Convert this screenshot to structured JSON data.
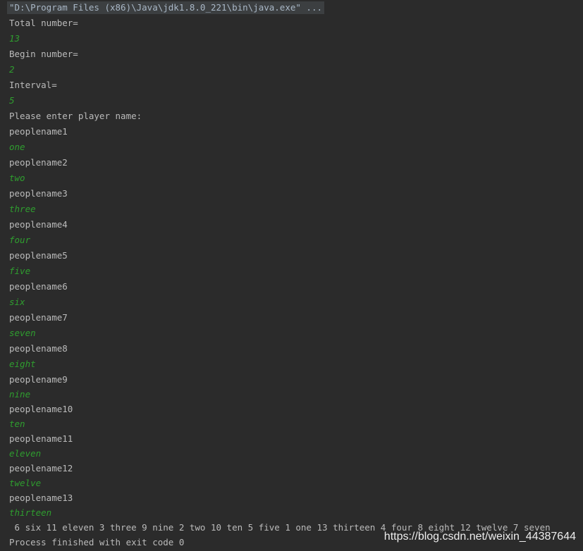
{
  "console": {
    "command": "\"D:\\Program Files (x86)\\Java\\jdk1.8.0_221\\bin\\java.exe\" ...",
    "lines": [
      {
        "text": "Total number=",
        "kind": "output"
      },
      {
        "text": "13",
        "kind": "input"
      },
      {
        "text": "Begin number=",
        "kind": "output"
      },
      {
        "text": "2",
        "kind": "input"
      },
      {
        "text": "Interval=",
        "kind": "output"
      },
      {
        "text": "5",
        "kind": "input"
      },
      {
        "text": "Please enter player name:",
        "kind": "output"
      },
      {
        "text": "peoplename1",
        "kind": "output"
      },
      {
        "text": "one",
        "kind": "input"
      },
      {
        "text": "peoplename2",
        "kind": "output"
      },
      {
        "text": "two",
        "kind": "input"
      },
      {
        "text": "peoplename3",
        "kind": "output"
      },
      {
        "text": "three",
        "kind": "input"
      },
      {
        "text": "peoplename4",
        "kind": "output"
      },
      {
        "text": "four",
        "kind": "input"
      },
      {
        "text": "peoplename5",
        "kind": "output"
      },
      {
        "text": "five",
        "kind": "input"
      },
      {
        "text": "peoplename6",
        "kind": "output"
      },
      {
        "text": "six",
        "kind": "input"
      },
      {
        "text": "peoplename7",
        "kind": "output"
      },
      {
        "text": "seven",
        "kind": "input"
      },
      {
        "text": "peoplename8",
        "kind": "output"
      },
      {
        "text": "eight",
        "kind": "input"
      },
      {
        "text": "peoplename9",
        "kind": "output"
      },
      {
        "text": "nine",
        "kind": "input"
      },
      {
        "text": "peoplename10",
        "kind": "output"
      },
      {
        "text": "ten",
        "kind": "input"
      },
      {
        "text": "peoplename11",
        "kind": "output"
      },
      {
        "text": "eleven",
        "kind": "input"
      },
      {
        "text": "peoplename12",
        "kind": "output"
      },
      {
        "text": "twelve",
        "kind": "input"
      },
      {
        "text": "peoplename13",
        "kind": "output"
      },
      {
        "text": "thirteen",
        "kind": "input"
      },
      {
        "text": " 6 six 11 eleven 3 three 9 nine 2 two 10 ten 5 five 1 one 13 thirteen 4 four 8 eight 12 twelve 7 seven",
        "kind": "output"
      },
      {
        "text": "Process finished with exit code 0",
        "kind": "output"
      }
    ]
  },
  "watermark": "https://blog.csdn.net/weixin_44387644",
  "colors": {
    "background": "#2b2b2b",
    "output_text": "#bbbbbb",
    "input_text": "#2f9e2f",
    "command_bg": "#3c3f41"
  }
}
